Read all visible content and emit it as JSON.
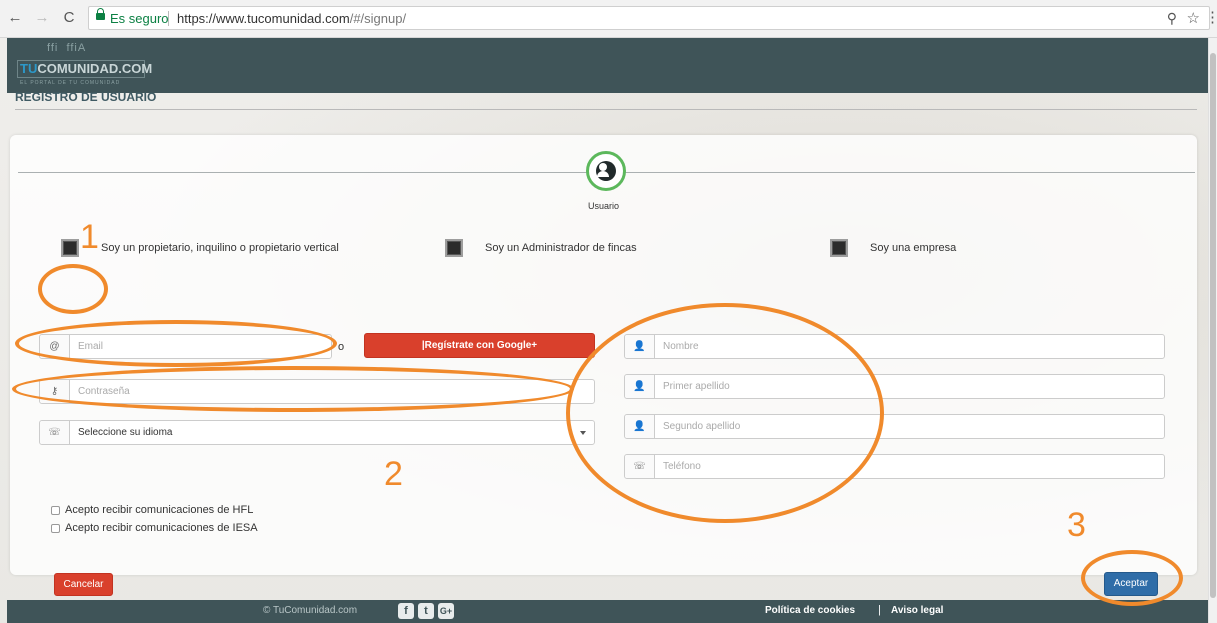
{
  "browser": {
    "secure_label": "Es seguro",
    "url_prefix": "https://www.tucomunidad.com",
    "url_suffix": "/#/signup/"
  },
  "header": {
    "logo_deco": "ffi  ffiA",
    "logo_tu": "TU",
    "logo_rest": "COMUNIDAD.COM",
    "logo_sub": "EL PORTAL DE TU COMUNIDAD"
  },
  "page": {
    "title": "REGISTRO DE USUARIO"
  },
  "stepper": {
    "label": "Usuario"
  },
  "roles": [
    {
      "label": "Soy un propietario, inquilino o propietario vertical"
    },
    {
      "label": "Soy un Administrador de fincas"
    },
    {
      "label": "Soy una empresa"
    }
  ],
  "form": {
    "email_placeholder": "Email",
    "or_text": "o",
    "google_button": "|Regístrate con Google+",
    "password_placeholder": "Contraseña",
    "language_value": "Seleccione su idioma",
    "name_placeholder": "Nombre",
    "surname1_placeholder": "Primer apellido",
    "surname2_placeholder": "Segundo apellido",
    "phone_placeholder": "Teléfono",
    "consent_hfl": "Acepto recibir comunicaciones de HFL",
    "consent_iesa": "Acepto recibir comunicaciones de IESA",
    "cancel_label": "Cancelar",
    "accept_label": "Aceptar"
  },
  "footer": {
    "copyright": "© TuComunidad.com",
    "cookies": "Política de cookies",
    "separator": "|",
    "legal": "Aviso legal"
  },
  "annotations": {
    "num1": "1",
    "num2": "2",
    "num3": "3",
    "color": "#f08a2c"
  },
  "icons": [
    "back-icon",
    "forward-icon",
    "reload-icon",
    "lock-icon",
    "zoom-icon",
    "star-icon",
    "menu-icon",
    "at-icon",
    "key-icon",
    "phone-icon",
    "user-icon",
    "google-plus-icon",
    "facebook-icon",
    "twitter-icon"
  ]
}
